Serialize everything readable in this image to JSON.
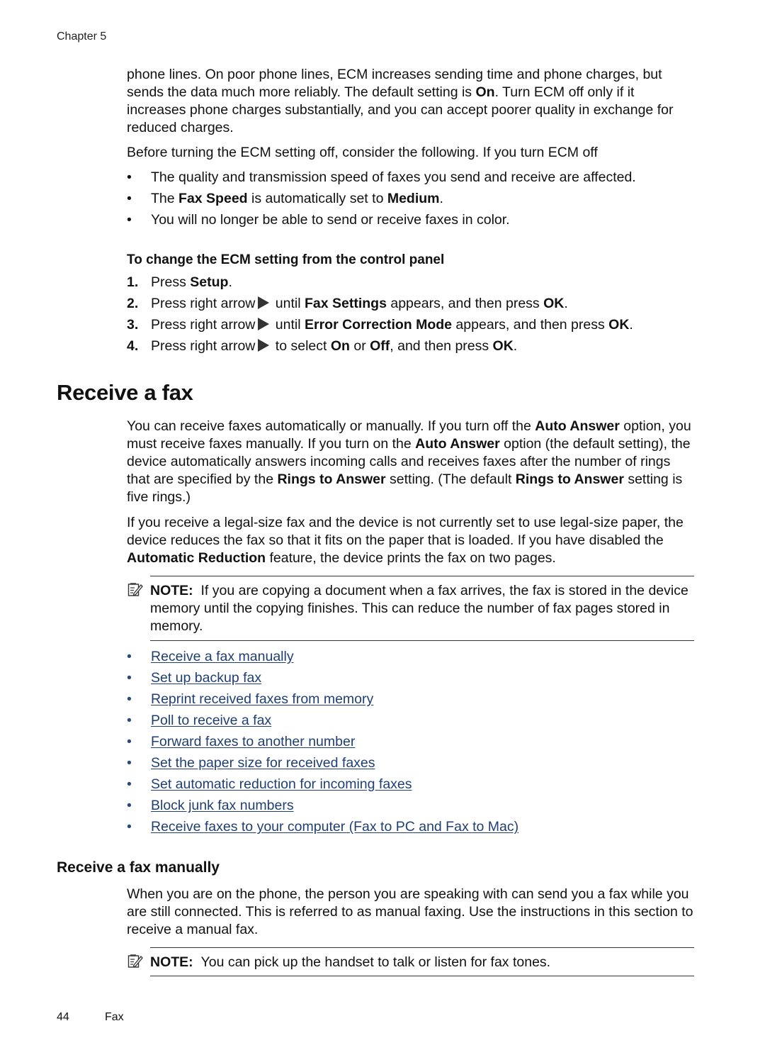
{
  "header": {
    "chapter": "Chapter 5"
  },
  "intro": {
    "para1": {
      "pre": "phone lines. On poor phone lines, ECM increases sending time and phone charges, but sends the data much more reliably. The default setting is ",
      "bold": "On",
      "post": ". Turn ECM off only if it increases phone charges substantially, and you can accept poorer quality in exchange for reduced charges."
    },
    "para2": "Before turning the ECM setting off, consider the following. If you turn ECM off",
    "bullets": [
      {
        "text": "The quality and transmission speed of faxes you send and receive are affected."
      },
      {
        "pre": "The ",
        "b1": "Fax Speed",
        "mid": " is automatically set to ",
        "b2": "Medium",
        "post": "."
      },
      {
        "text": "You will no longer be able to send or receive faxes in color."
      }
    ],
    "bullet_char": "•"
  },
  "procedure": {
    "heading": "To change the ECM setting from the control panel",
    "steps": [
      {
        "num": "1.",
        "pre": "Press ",
        "b1": "Setup",
        "post": "."
      },
      {
        "num": "2.",
        "pre": "Press right arrow",
        "mid": " until ",
        "b1": "Fax Settings",
        "mid2": " appears, and then press ",
        "b2": "OK",
        "post": "."
      },
      {
        "num": "3.",
        "pre": "Press right arrow",
        "mid": " until ",
        "b1": "Error Correction Mode",
        "mid2": " appears, and then press ",
        "b2": "OK",
        "post": "."
      },
      {
        "num": "4.",
        "pre": "Press right arrow",
        "mid": " to select ",
        "b1": "On",
        "mid2": " or ",
        "b2": "Off",
        "mid3": ", and then press ",
        "b3": "OK",
        "post": "."
      }
    ],
    "arrow_icon": "right-arrow-icon"
  },
  "receive_section": {
    "title": "Receive a fax",
    "para1": {
      "s1": "You can receive faxes automatically or manually. If you turn off the ",
      "b1": "Auto Answer",
      "s2": " option, you must receive faxes manually. If you turn on the ",
      "b2": "Auto Answer",
      "s3": " option (the default setting), the device automatically answers incoming calls and receives faxes after the number of rings that are specified by the ",
      "b3": "Rings to Answer",
      "s4": " setting. (The default ",
      "b4": "Rings to Answer",
      "s5": " setting is five rings.)"
    },
    "para2": {
      "s1": "If you receive a legal-size fax and the device is not currently set to use legal-size paper, the device reduces the fax so that it fits on the paper that is loaded. If you have disabled the ",
      "b1": "Automatic Reduction",
      "s2": " feature, the device prints the fax on two pages."
    },
    "note": {
      "label": "NOTE:",
      "text": "If you are copying a document when a fax arrives, the fax is stored in the device memory until the copying finishes. This can reduce the number of fax pages stored in memory.",
      "icon": "note-pencil-icon"
    },
    "links": [
      "Receive a fax manually",
      "Set up backup fax",
      "Reprint received faxes from memory",
      "Poll to receive a fax",
      "Forward faxes to another number",
      "Set the paper size for received faxes",
      "Set automatic reduction for incoming faxes",
      "Block junk fax numbers",
      "Receive faxes to your computer (Fax to PC and Fax to Mac)"
    ],
    "link_color": "#1f3f73"
  },
  "manual_section": {
    "title": "Receive a fax manually",
    "para": "When you are on the phone, the person you are speaking with can send you a fax while you are still connected. This is referred to as manual faxing. Use the instructions in this section to receive a manual fax.",
    "note": {
      "label": "NOTE:",
      "text": "You can pick up the handset to talk or listen for fax tones."
    }
  },
  "footer": {
    "page_number": "44",
    "section": "Fax"
  }
}
